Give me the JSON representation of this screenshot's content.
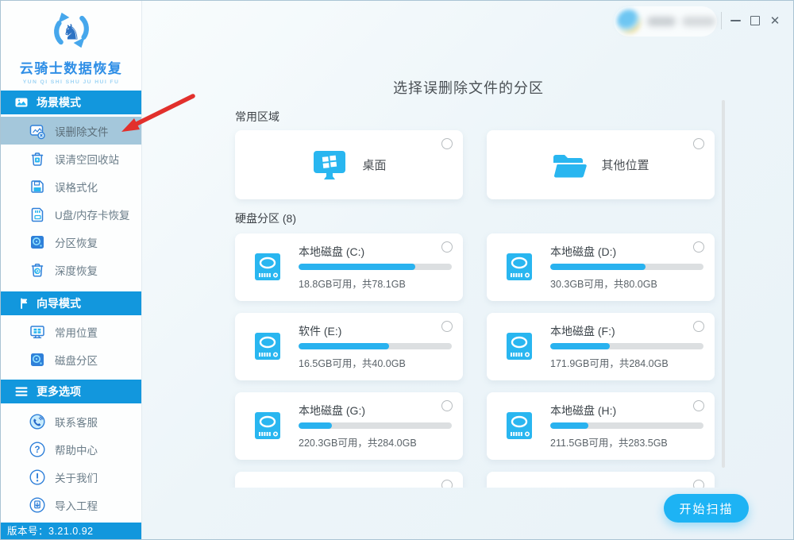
{
  "sidebar": {
    "logo": {
      "title": "云骑士数据恢复",
      "subtitle": "YUN QI SHI SHU JU HUI FU",
      "knight_glyph": "♞"
    },
    "sections": [
      {
        "label": "场景模式",
        "icon": "scene-mode-icon",
        "items": [
          {
            "label": "误删除文件",
            "icon": "file-delete-icon",
            "selected": true
          },
          {
            "label": "误清空回收站",
            "icon": "recycle-bin-icon"
          },
          {
            "label": "误格式化",
            "icon": "floppy-format-icon"
          },
          {
            "label": "U盘/内存卡恢复",
            "icon": "sd-card-icon"
          },
          {
            "label": "分区恢复",
            "icon": "disk-partition-icon"
          },
          {
            "label": "深度恢复",
            "icon": "deep-recovery-icon"
          }
        ]
      },
      {
        "label": "向导模式",
        "icon": "signpost-icon",
        "items": [
          {
            "label": "常用位置",
            "icon": "monitor-icon"
          },
          {
            "label": "磁盘分区",
            "icon": "disk-icon"
          }
        ]
      },
      {
        "label": "更多选项",
        "icon": "menu-icon",
        "items": [
          {
            "label": "联系客服",
            "icon": "phone-icon"
          },
          {
            "label": "帮助中心",
            "icon": "question-icon"
          },
          {
            "label": "关于我们",
            "icon": "exclamation-icon"
          },
          {
            "label": "导入工程",
            "icon": "import-icon"
          }
        ]
      }
    ],
    "version": "版本号：3.21.0.92"
  },
  "titlebar": {
    "close_glyph": "✕"
  },
  "main": {
    "title": "选择误删除文件的分区",
    "common_section_label": "常用区域",
    "common_items": [
      {
        "label": "桌面",
        "icon": "desktop-windows-icon"
      },
      {
        "label": "其他位置",
        "icon": "open-folder-icon"
      }
    ],
    "partition_section_label": "硬盘分区 (8)",
    "partition_count": 8,
    "partitions": [
      {
        "name": "本地磁盘 (C:)",
        "info": "18.8GB可用，共78.1GB",
        "used_percent": 76
      },
      {
        "name": "本地磁盘 (D:)",
        "info": "30.3GB可用，共80.0GB",
        "used_percent": 62
      },
      {
        "name": "软件 (E:)",
        "info": "16.5GB可用，共40.0GB",
        "used_percent": 59
      },
      {
        "name": "本地磁盘 (F:)",
        "info": "171.9GB可用，共284.0GB",
        "used_percent": 39
      },
      {
        "name": "本地磁盘 (G:)",
        "info": "220.3GB可用，共284.0GB",
        "used_percent": 22
      },
      {
        "name": "本地磁盘 (H:)",
        "info": "211.5GB可用，共283.5GB",
        "used_percent": 25
      }
    ],
    "scan_button_label": "开始扫描"
  },
  "colors": {
    "header_blue": "#1297dd",
    "accent_cyan": "#1db3f4",
    "selected_item": "#a4c7db",
    "progress_track": "#dcdfe1",
    "progress_fill": "#29b2ef",
    "arrow_red": "#e2302c"
  }
}
